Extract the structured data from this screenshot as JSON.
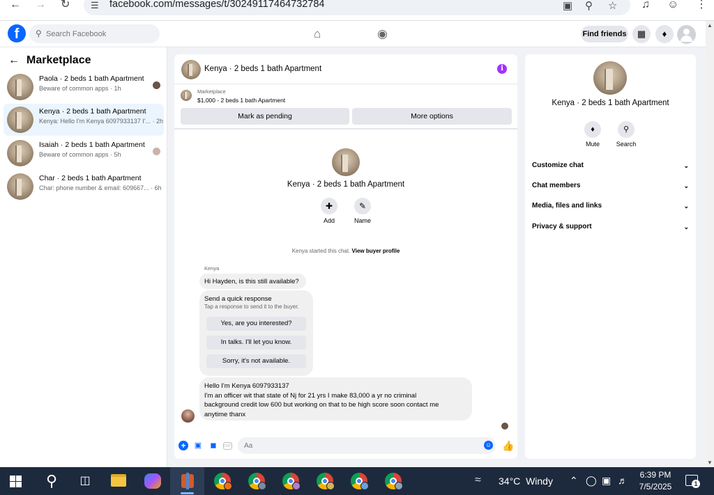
{
  "browser": {
    "url": "facebook.com/messages/t/30249117464732784",
    "back_icon": "arrow-left-icon",
    "forward_icon": "arrow-right-icon",
    "reload_icon": "reload-icon"
  },
  "fb": {
    "search_placeholder": "Search Facebook",
    "find_friends": "Find friends"
  },
  "left": {
    "title": "Marketplace",
    "conversations": [
      {
        "name": "Paola · 2 beds 1 bath Apartment",
        "preview": "Beware of common apps · 1h",
        "active": false
      },
      {
        "name": "Kenya · 2 beds 1 bath Apartment",
        "preview": "Kenya: Hello I'm Kenya 6097933137 I'... · 2h",
        "active": true
      },
      {
        "name": "Isaiah · 2 beds 1 bath Apartment",
        "preview": "Beware of common apps · 5h",
        "active": false
      },
      {
        "name": "Char · 2 beds 1 bath Apartment",
        "preview": "Char: phone number & email: 609667... · 6h",
        "active": false
      }
    ]
  },
  "chat": {
    "title": "Kenya · 2 beds 1 bath Apartment",
    "marketplace_label": "Marketplace",
    "listing": "$1,000 - 2 beds 1 bath Apartment",
    "mark_pending": "Mark as pending",
    "more_options": "More options",
    "intro_name": "Kenya · 2 beds 1 bath Apartment",
    "add_label": "Add",
    "name_label": "Name",
    "started_note": "Kenya started this chat.",
    "view_profile": "View buyer profile",
    "sender": "Kenya",
    "message1": "Hi Hayden, is this still available?",
    "quick_title": "Send a quick response",
    "quick_sub": "Tap a response to send it to the buyer.",
    "quick_replies": [
      "Yes, are you interested?",
      "In talks. I'll let you know.",
      "Sorry, it's not available."
    ],
    "message2_lines": [
      "Hello I'm Kenya 6097933137",
      "I'm an officer wit that state of Nj for 21 yrs I make 83,000 a yr no criminal",
      "background credit low 600 but working on that to be high score soon contact me",
      "anytime thanx"
    ],
    "input_placeholder": "Aa",
    "gif_label": "GIF"
  },
  "right": {
    "name": "Kenya · 2 beds 1 bath Apartment",
    "mute": "Mute",
    "search": "Search",
    "rows": [
      "Customize chat",
      "Chat members",
      "Media, files and links",
      "Privacy & support"
    ]
  },
  "taskbar": {
    "temperature": "34°C",
    "condition": "Windy",
    "time": "6:39 PM",
    "date": "7/5/2025",
    "notifications": "1"
  },
  "colors": {
    "facebook_blue": "#0866ff",
    "info_purple": "#a033ff",
    "active_convo": "#ebf5ff",
    "taskbar": "#1d2a3d"
  }
}
